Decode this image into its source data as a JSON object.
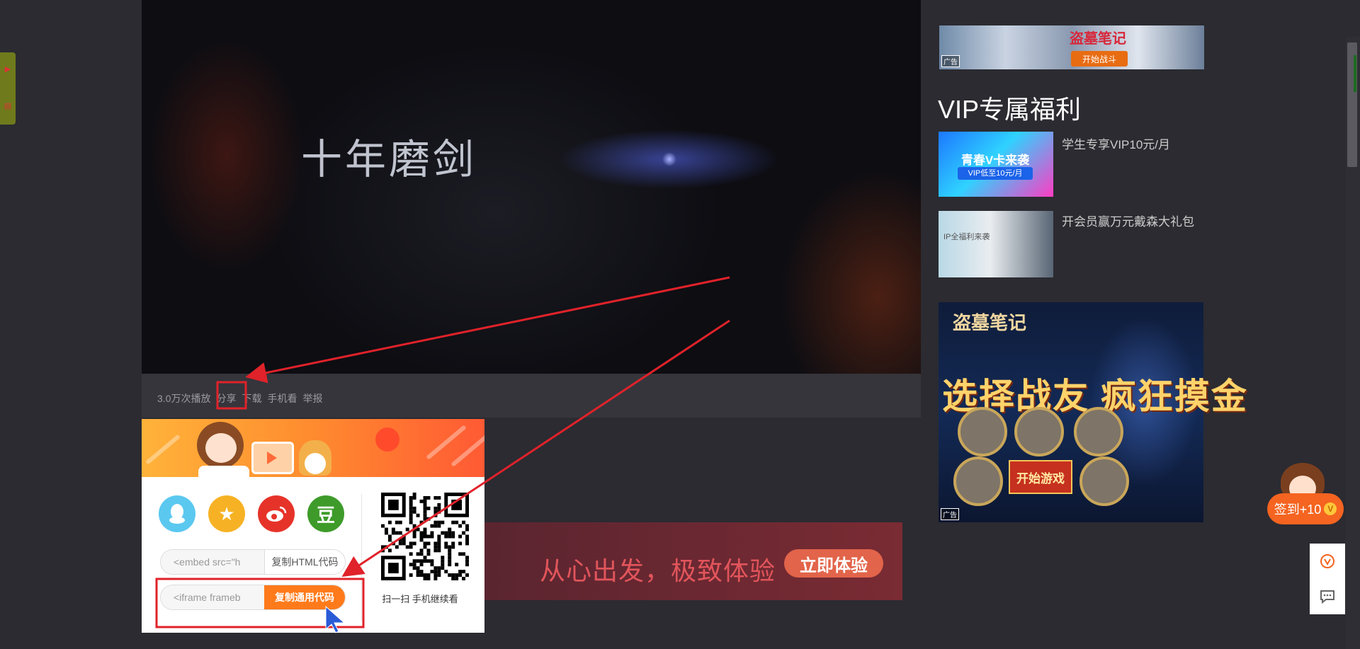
{
  "player": {
    "title_text": "十年磨剑",
    "meta": {
      "plays": "3.0万次播放",
      "share": "分享",
      "download": "下载",
      "mobile": "手机看",
      "report": "举报"
    }
  },
  "share_popup": {
    "buttons": {
      "qq": "qq-icon",
      "qzone": "qzone-star-icon",
      "weibo": "weibo-icon",
      "douban": "豆"
    },
    "embed_value": "<embed src=\"h",
    "embed_button": "复制HTML代码",
    "iframe_value": "<iframe frameb",
    "iframe_button": "复制通用代码",
    "qr_caption": "扫一扫 手机继续看"
  },
  "promo": {
    "text": "从心出发，极致体验",
    "button": "立即体验"
  },
  "sidebar": {
    "ad_top": {
      "logo": "盗墓笔记",
      "button": "开始战斗",
      "tag": "广告"
    },
    "vip_heading": "VIP专属福利",
    "vip_items": [
      {
        "thumb_text": "青春V卡来袭",
        "thumb_sub": "VIP低至10元/月",
        "title": "学生专享VIP10元/月"
      },
      {
        "thumb_text": "IP全福利来袭",
        "title": "开会员赢万元戴森大礼包"
      }
    ],
    "ad_big": {
      "logo": "盗墓笔记",
      "slogan": "选择战友 疯狂摸金",
      "button": "开始游戏",
      "tag": "广告"
    }
  },
  "floating": {
    "checkin": "签到+10",
    "checkin_badge": "V",
    "tool_vip": "v-circle-icon",
    "tool_feedback": "chat-bubble-icon"
  },
  "colors": {
    "background": "#2b2b31",
    "accent_orange": "#ff7a1a",
    "annotation_red": "#e0222a"
  }
}
